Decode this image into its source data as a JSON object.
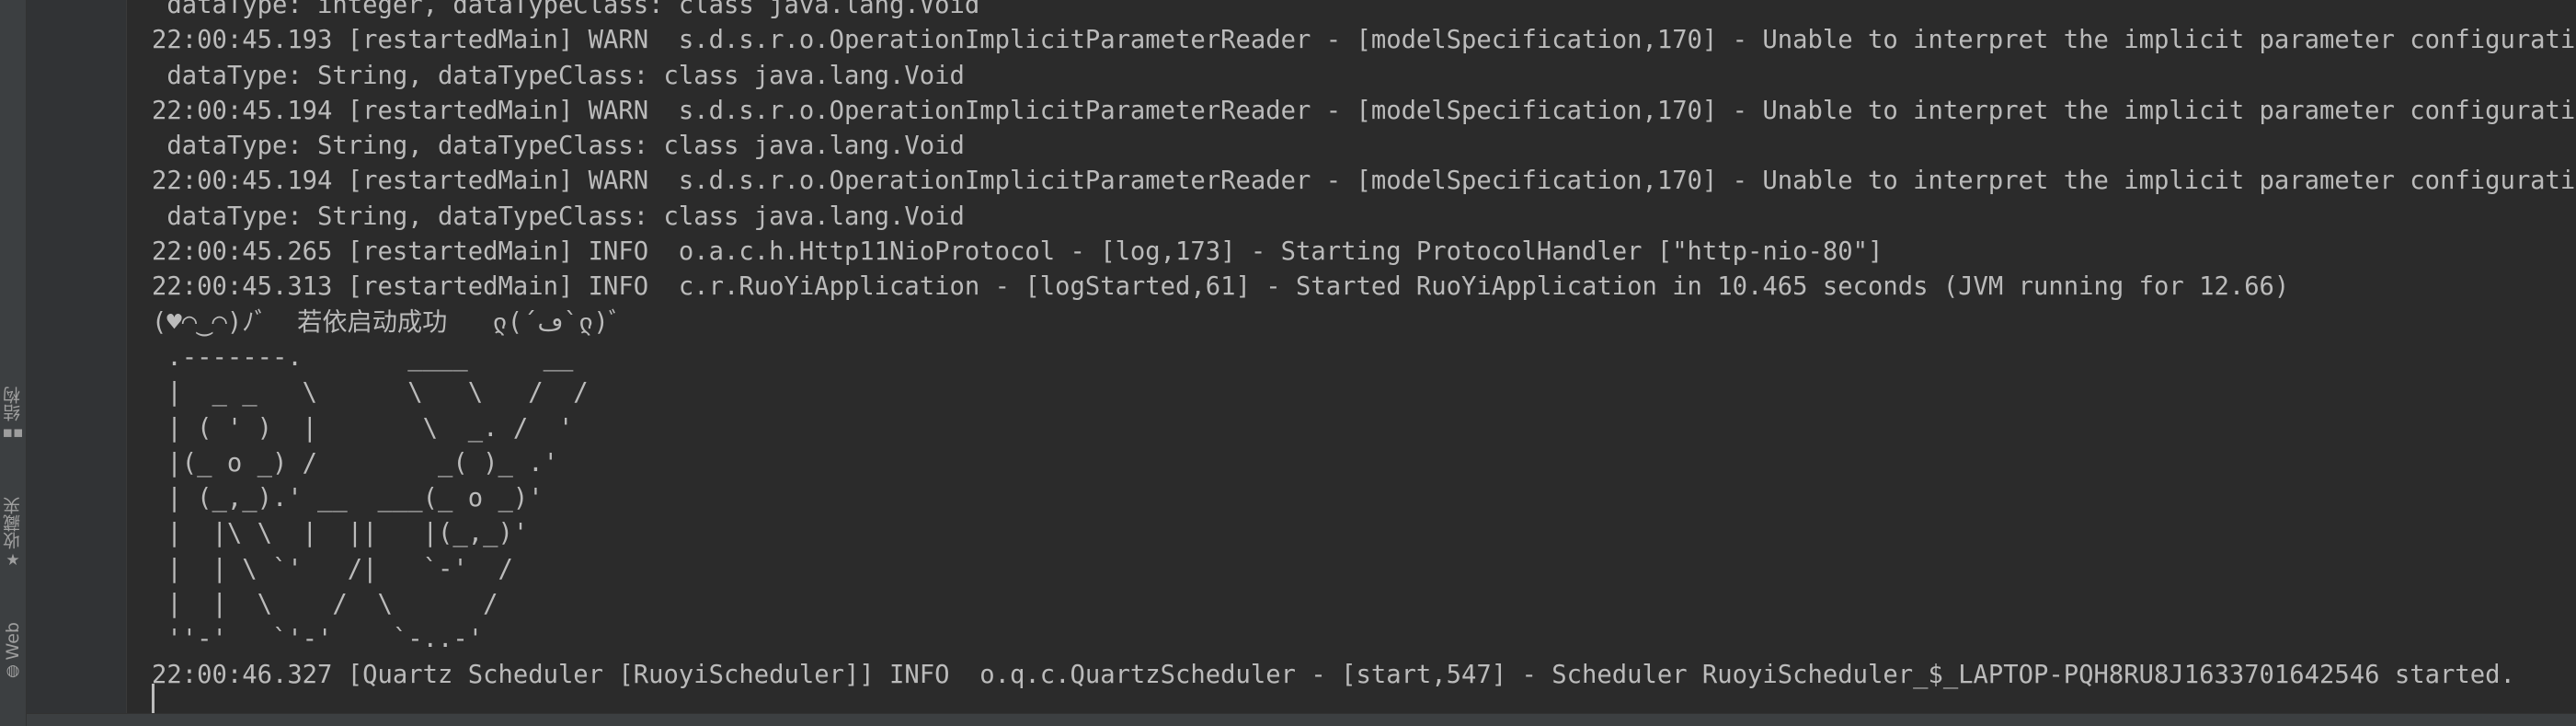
{
  "side_panel": {
    "items": [
      {
        "label": "结构",
        "icon": "structure-icon",
        "glyph": "▪▪"
      },
      {
        "label": "收藏夹",
        "icon": "favorites-star-icon",
        "glyph": "★"
      },
      {
        "label": "Web",
        "icon": "web-globe-icon",
        "glyph": "◍"
      }
    ]
  },
  "console": {
    "lines": [
      " dataType: integer, dataTypeClass: class java.lang.Void",
      "22:00:45.193 [restartedMain] WARN  s.d.s.r.o.OperationImplicitParameterReader - [modelSpecification,170] - Unable to interpret the implicit parameter configuration w",
      " dataType: String, dataTypeClass: class java.lang.Void",
      "22:00:45.194 [restartedMain] WARN  s.d.s.r.o.OperationImplicitParameterReader - [modelSpecification,170] - Unable to interpret the implicit parameter configuration w",
      " dataType: String, dataTypeClass: class java.lang.Void",
      "22:00:45.194 [restartedMain] WARN  s.d.s.r.o.OperationImplicitParameterReader - [modelSpecification,170] - Unable to interpret the implicit parameter configuration w",
      " dataType: String, dataTypeClass: class java.lang.Void",
      "22:00:45.265 [restartedMain] INFO  o.a.c.h.Http11NioProtocol - [log,173] - Starting ProtocolHandler [\"http-nio-80\"]",
      "22:00:45.313 [restartedMain] INFO  c.r.RuoYiApplication - [logStarted,61] - Started RuoYiApplication in 10.465 seconds (JVM running for 12.66)",
      "(♥◠‿◠)ﾉﾞ  若依启动成功   ლ(´ڡ`ლ)ﾞ",
      " .-------.       ____     __",
      " |  _ _   \\      \\   \\   /  /",
      " | ( ' )  |       \\  _. /  '",
      " |(_ o _) /        _( )_ .'",
      " | (_,_).' __  ___(_ o _)'",
      " |  |\\ \\  |  ||   |(_,_)'",
      " |  | \\ `'   /|   `-'  /",
      " |  |  \\    /  \\      /",
      " ''-'   `'-'    `-..-'",
      "22:00:46.327 [Quartz Scheduler [RuoyiScheduler]] INFO  o.q.c.QuartzScheduler - [start,547] - Scheduler RuoyiScheduler_$_LAPTOP-PQH8RU8J1633701642546 started."
    ]
  },
  "colors": {
    "background": "#2b2b2b",
    "text": "#bbbbbb",
    "gutter": "#313335",
    "tool_strip": "#3c3f41"
  }
}
